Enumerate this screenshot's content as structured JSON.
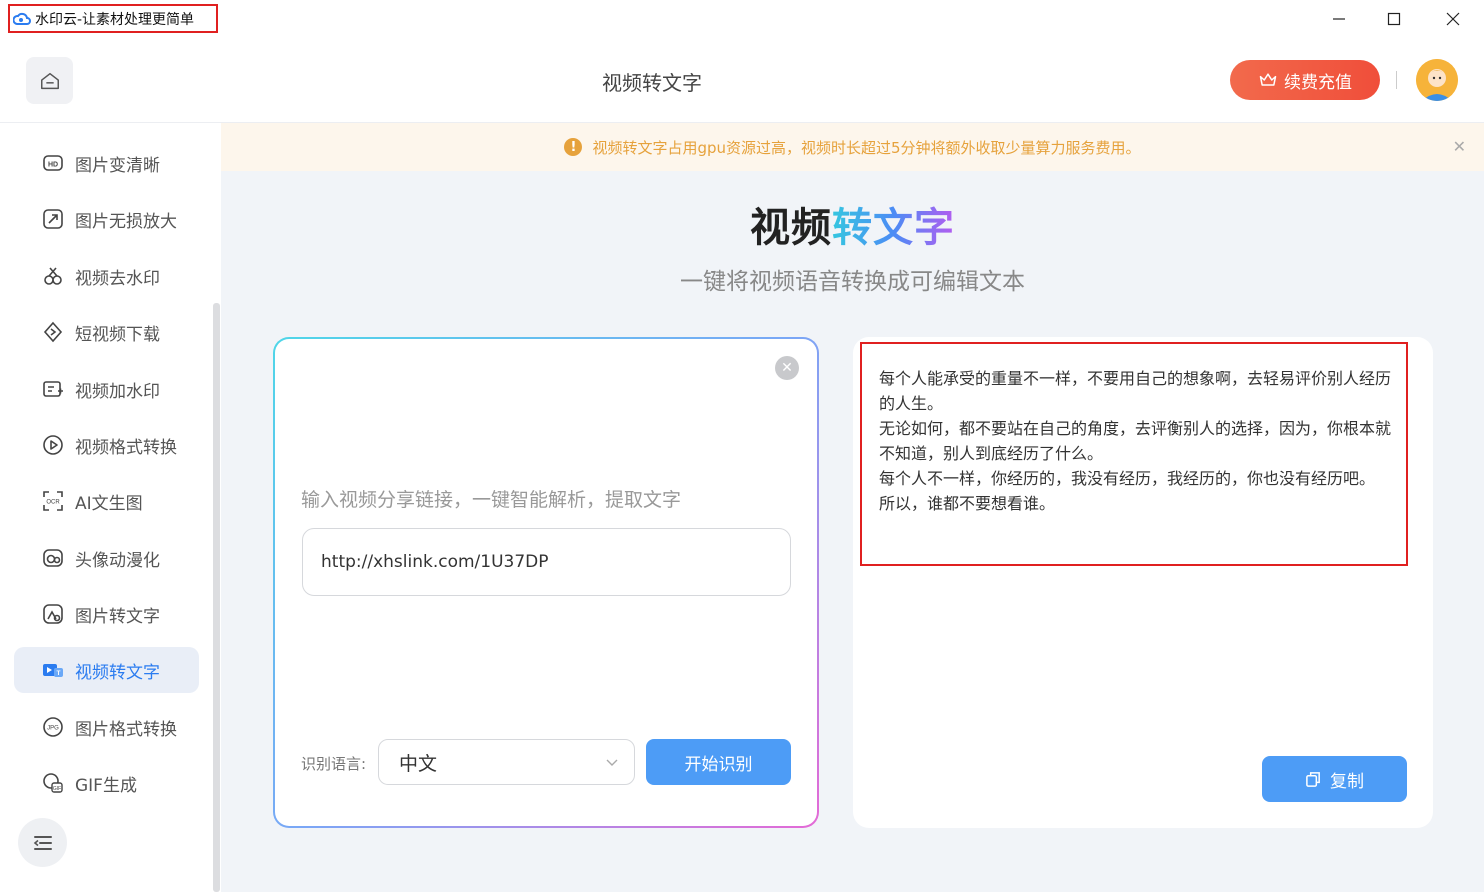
{
  "window": {
    "title": "水印云-让素材处理更简单"
  },
  "header": {
    "title": "视频转文字",
    "vip_label": "续费充值"
  },
  "sidebar": {
    "items": [
      {
        "label": "图片变清晰",
        "icon": "hd-icon"
      },
      {
        "label": "图片无损放大",
        "icon": "enlarge-icon"
      },
      {
        "label": "视频去水印",
        "icon": "video-remove-watermark-icon"
      },
      {
        "label": "短视频下载",
        "icon": "download-icon"
      },
      {
        "label": "视频加水印",
        "icon": "video-add-watermark-icon"
      },
      {
        "label": "视频格式转换",
        "icon": "play-circle-icon"
      },
      {
        "label": "AI文生图",
        "icon": "ocr-icon"
      },
      {
        "label": "头像动漫化",
        "icon": "avatar-anime-icon"
      },
      {
        "label": "图片转文字",
        "icon": "image-to-text-icon"
      },
      {
        "label": "视频转文字",
        "icon": "video-to-text-icon"
      },
      {
        "label": "图片格式转换",
        "icon": "jpg-icon"
      },
      {
        "label": "GIF生成",
        "icon": "gif-icon"
      }
    ],
    "active_index": 9
  },
  "notice": {
    "text": "视频转文字占用gpu资源过高，视频时长超过5分钟将额外收取少量算力服务费用。"
  },
  "hero": {
    "title_part1": "视频",
    "title_part2": "转文字",
    "subtitle": "一键将视频语音转换成可编辑文本"
  },
  "input_panel": {
    "hint": "输入视频分享链接，一键智能解析，提取文字",
    "url_value": "http://xhslink.com/1U37DP",
    "language_label": "识别语言:",
    "language_value": "中文",
    "start_label": "开始识别"
  },
  "output_panel": {
    "lines": [
      "每个人能承受的重量不一样，不要用自己的想象啊，去轻易评价别人经历的人生。",
      "无论如何，都不要站在自己的角度，去评衡别人的选择，因为，你根本就不知道，别人到底经历了什么。",
      "每个人不一样，你经历的，我没有经历，我经历的，你也没有经历吧。",
      "所以，谁都不要想看谁。"
    ],
    "copy_label": "复制"
  },
  "colors": {
    "accent": "#4d9cf6",
    "vip": "#f04e3a",
    "notice": "#e6a23c",
    "active_nav": "#2b7cf0"
  }
}
